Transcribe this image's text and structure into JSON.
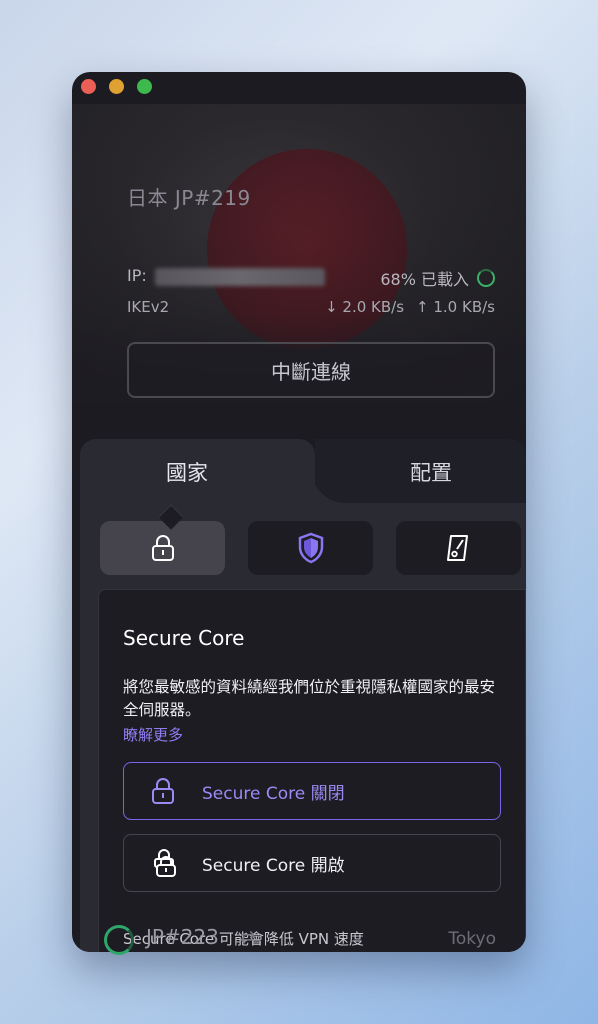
{
  "window": {
    "hero": {
      "server_title": "日本 JP#219",
      "ip_label": "IP:",
      "load_text": "68% 已載入",
      "protocol": "IKEv2",
      "download": "↓ 2.0 KB/s",
      "upload": "↑ 1.0 KB/s",
      "disconnect_label": "中斷連線"
    },
    "tabs": [
      {
        "label": "國家",
        "selected": true
      },
      {
        "label": "配置",
        "selected": false
      }
    ],
    "features": [
      {
        "icon": "lock-icon",
        "selected": true
      },
      {
        "icon": "shield-icon",
        "selected": false
      },
      {
        "icon": "tor-card-icon",
        "selected": false
      }
    ],
    "popover": {
      "title": "Secure Core",
      "description": "將您最敏感的資料繞經我們位於重視隱私權國家的最安全伺服器。",
      "learn_more": "瞭解更多",
      "option_off": "Secure Core 關閉",
      "option_on": "Secure Core 開啟",
      "note": "Secure Core 可能會降低 VPN 速度"
    },
    "bottom": {
      "server": "JP#223",
      "city": "Tokyo"
    }
  },
  "colors": {
    "accent": "#7a64e8",
    "accent_text": "#9b8af4",
    "green": "#3ab26a",
    "window_bg": "#1c1b22"
  }
}
